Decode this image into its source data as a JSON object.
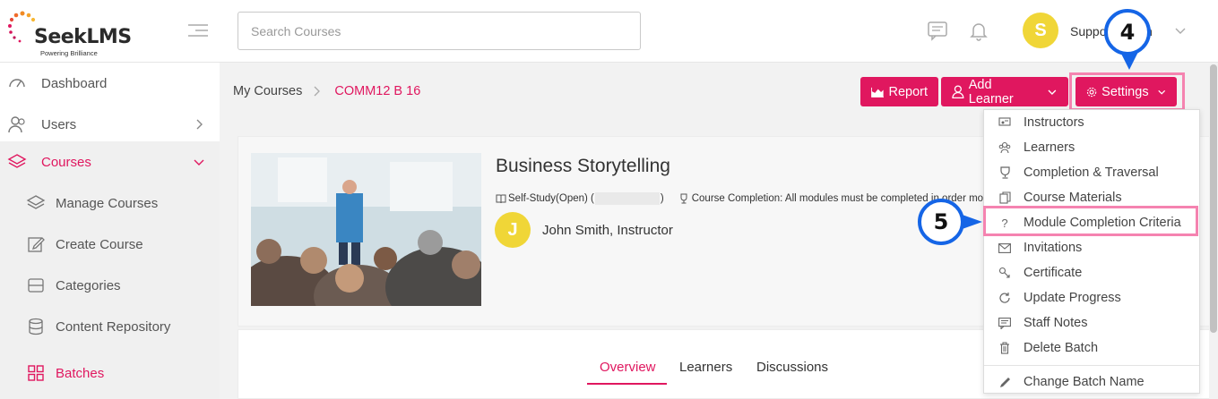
{
  "brand": {
    "name": "SeekLMS",
    "tagline": "Powering Brilliance",
    "accent": "#e0175f"
  },
  "header": {
    "search_placeholder": "Search Courses",
    "user_initial": "S",
    "user_name": "Support Admin",
    "icons": [
      "chat-icon",
      "bell-icon",
      "chevron-down-icon"
    ]
  },
  "sidebar": {
    "items": [
      {
        "label": "Dashboard",
        "icon": "gauge-icon"
      },
      {
        "label": "Users",
        "icon": "users-icon"
      },
      {
        "label": "Courses",
        "icon": "layers-icon"
      },
      {
        "label": "Manage Courses",
        "icon": "layers-icon"
      },
      {
        "label": "Create Course",
        "icon": "edit-icon"
      },
      {
        "label": "Categories",
        "icon": "folders-icon"
      },
      {
        "label": "Content Repository",
        "icon": "database-icon"
      },
      {
        "label": "Batches",
        "icon": "grid-icon"
      }
    ]
  },
  "breadcrumb": {
    "root": "My Courses",
    "current": "COMM12 B 16"
  },
  "actions": {
    "report": "Report",
    "add_learner": "Add Learner",
    "settings": "Settings"
  },
  "course": {
    "title": "Business Storytelling",
    "type_prefix": "Self-Study(Open) (",
    "type_suffix": ")",
    "completion": "Course Completion: All modules must be completed in order mo",
    "instructor_initial": "J",
    "instructor": "John Smith, Instructor"
  },
  "tabs": [
    "Overview",
    "Learners",
    "Discussions"
  ],
  "settings_menu": {
    "items": [
      {
        "label": "Instructors",
        "icon": "instructor-icon"
      },
      {
        "label": "Learners",
        "icon": "learners-icon"
      },
      {
        "label": "Completion & Traversal",
        "icon": "trophy-icon"
      },
      {
        "label": "Course Materials",
        "icon": "materials-icon"
      },
      {
        "label": "Module Completion Criteria",
        "icon": "question-icon"
      },
      {
        "label": "Invitations",
        "icon": "envelope-icon"
      },
      {
        "label": "Certificate",
        "icon": "certificate-icon"
      },
      {
        "label": "Update Progress",
        "icon": "refresh-icon"
      },
      {
        "label": "Staff Notes",
        "icon": "notes-icon"
      },
      {
        "label": "Delete Batch",
        "icon": "trash-icon"
      },
      {
        "label": "Change Batch Name",
        "icon": "pencil-icon"
      }
    ]
  },
  "callouts": {
    "step4": "4",
    "step5": "5"
  }
}
